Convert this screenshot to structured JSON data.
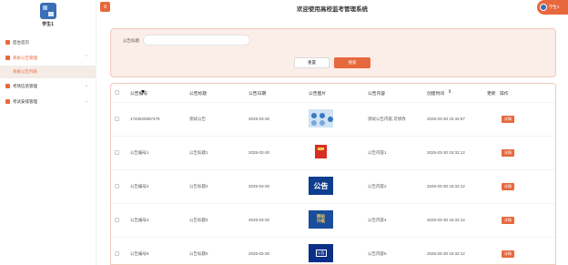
{
  "sidebar": {
    "username": "学生1",
    "items": [
      {
        "label": "后台首页"
      },
      {
        "label": "系统公告管理"
      },
      {
        "label": "系统公告列表"
      },
      {
        "label": "考场信息管理"
      },
      {
        "label": "考试安排管理"
      }
    ]
  },
  "header": {
    "title": "欢迎使用高校监考管理系统",
    "menu_icon": "≡",
    "user_label": "学生1"
  },
  "search": {
    "label": "公告标题",
    "placeholder": "",
    "value": "",
    "reset_label": "重置",
    "search_label": "搜索"
  },
  "table": {
    "columns": [
      "公告编号",
      "公告标题",
      "公告日期",
      "公告图片",
      "公告内容",
      "创建时间",
      "更新",
      "操作"
    ],
    "sort_indicator": "⇕",
    "rows": [
      {
        "id": "1743520087479",
        "title": "测试公告",
        "date": "2025-03-30",
        "content": "测试公告内容,可修改",
        "created": "2025-03-30 15:34:57",
        "thumb_type": "blue",
        "thumb_text": "",
        "action": "详情"
      },
      {
        "id": "公告编号1",
        "title": "公告标题1",
        "date": "2025-03-30",
        "content": "公告内容1",
        "created": "2025-03-30 15:32:12",
        "thumb_type": "red",
        "thumb_text": "",
        "action": "详情"
      },
      {
        "id": "公告编号2",
        "title": "公告标题2",
        "date": "2025-03-30",
        "content": "公告内容2",
        "created": "2025-03-30 15:32:12",
        "thumb_type": "navy",
        "thumb_text": "公告",
        "action": "详情"
      },
      {
        "id": "公告编号4",
        "title": "公告标题4",
        "date": "2025-03-30",
        "content": "公告内容4",
        "created": "2025-03-30 15:32:12",
        "thumb_type": "mix",
        "thumb_text": "网站\n升级",
        "action": "详情"
      },
      {
        "id": "公告编号5",
        "title": "公告标题5",
        "date": "2025-03-30",
        "content": "公告内容5",
        "created": "2025-03-30 15:32:12",
        "thumb_type": "deep",
        "thumb_text": "公告",
        "action": "详情"
      }
    ]
  },
  "colors": {
    "accent": "#e8683d",
    "panel_bg": "#fbede8"
  }
}
